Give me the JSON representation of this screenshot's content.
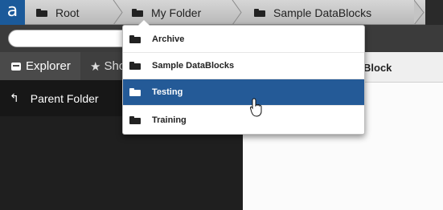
{
  "app": {
    "logo_letter": "a"
  },
  "breadcrumb": {
    "items": [
      {
        "label": "Root",
        "icon": "folder-icon"
      },
      {
        "label": "My Folder",
        "icon": "folder-icon"
      },
      {
        "label": "Sample DataBlocks",
        "icon": "folder-icon"
      }
    ]
  },
  "search": {
    "placeholder": "",
    "value": ""
  },
  "tabs": [
    {
      "label": "Explorer",
      "icon": "hard-drive-icon"
    },
    {
      "label": "Sho",
      "icon": "star-icon"
    }
  ],
  "left_pane": {
    "parent_label": "Parent Folder",
    "parent_icon": "back-arrow-icon"
  },
  "right_pane": {
    "header_partial": "Block"
  },
  "dropdown": {
    "items": [
      {
        "label": "Archive",
        "selected": false
      },
      {
        "label": "Sample DataBlocks",
        "selected": false
      },
      {
        "label": "Testing",
        "selected": true
      },
      {
        "label": "Training",
        "selected": false
      }
    ]
  },
  "colors": {
    "brand": "#1b5a9a",
    "selection": "#245a97",
    "topbar": "#c9c9c9",
    "dark_pane": "#1f1f1f"
  }
}
